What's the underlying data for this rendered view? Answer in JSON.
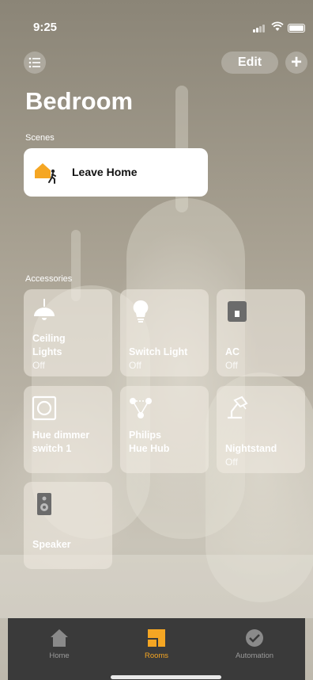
{
  "status_bar": {
    "time": "9:25"
  },
  "header": {
    "edit_label": "Edit",
    "add_label": "+"
  },
  "room": {
    "title": "Bedroom"
  },
  "scenes": {
    "section_label": "Scenes",
    "items": [
      {
        "label": "Leave Home",
        "icon": "leave-home-icon"
      }
    ]
  },
  "accessories": {
    "section_label": "Accessories",
    "items": [
      {
        "name_line1": "Ceiling",
        "name_line2": "Lights",
        "state": "Off",
        "icon": "ceiling-light-icon"
      },
      {
        "name_line1": "Switch Light",
        "state": "Off",
        "icon": "lightbulb-icon"
      },
      {
        "name_line1": "AC",
        "state": "Off",
        "icon": "switch-icon"
      },
      {
        "name_line1": "Hue dimmer",
        "name_line2": "switch 1",
        "icon": "dimmer-switch-icon"
      },
      {
        "name_line1": "Philips",
        "name_line2": "Hue Hub",
        "icon": "hub-icon"
      },
      {
        "name_line1": "Nightstand",
        "state": "Off",
        "icon": "desk-lamp-icon"
      },
      {
        "name_line1": "Speaker",
        "icon": "speaker-icon"
      }
    ]
  },
  "tabbar": {
    "tabs": [
      {
        "label": "Home",
        "icon": "home-icon"
      },
      {
        "label": "Rooms",
        "icon": "rooms-icon",
        "active": true
      },
      {
        "label": "Automation",
        "icon": "automation-icon"
      }
    ]
  },
  "colors": {
    "accent": "#f5a623",
    "tabbar": "#3a3a3a"
  }
}
